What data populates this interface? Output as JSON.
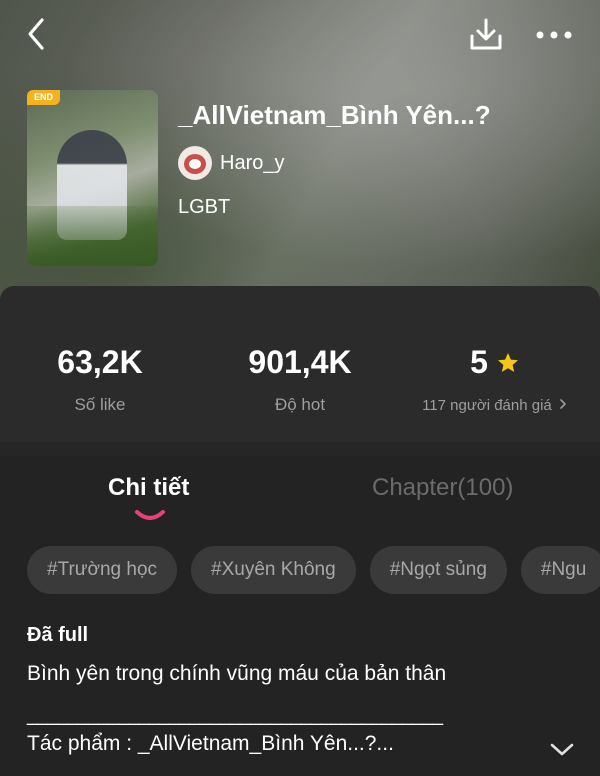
{
  "header": {
    "back_icon": "chevron-left-icon",
    "download_icon": "download-icon",
    "more_icon": "more-horizontal-icon"
  },
  "story": {
    "badge": "END",
    "title": "_AllVietnam_Bình Yên...?",
    "author": "Haro_y",
    "genre": "LGBT"
  },
  "stats": {
    "likes": {
      "value": "63,2K",
      "label": "Số like"
    },
    "hot": {
      "value": "901,4K",
      "label": "Độ hot"
    },
    "rating": {
      "value": "5",
      "label": "117 người đánh giá",
      "star_color": "#f5c518"
    }
  },
  "tabs": [
    {
      "label": "Chi tiết",
      "active": true
    },
    {
      "label": "Chapter(100)",
      "active": false
    }
  ],
  "accent_color": "#e8407a",
  "tags": [
    "#Trường học",
    "#Xuyên Không",
    "#Ngọt sủng",
    "#Ngu"
  ],
  "details": {
    "status": "Đã full",
    "description": "Bình yên trong chính vũng máu của bản thân",
    "divider": "_________________________________________",
    "work": "Tác phẩm : _AllVietnam_Bình Yên...?..."
  }
}
